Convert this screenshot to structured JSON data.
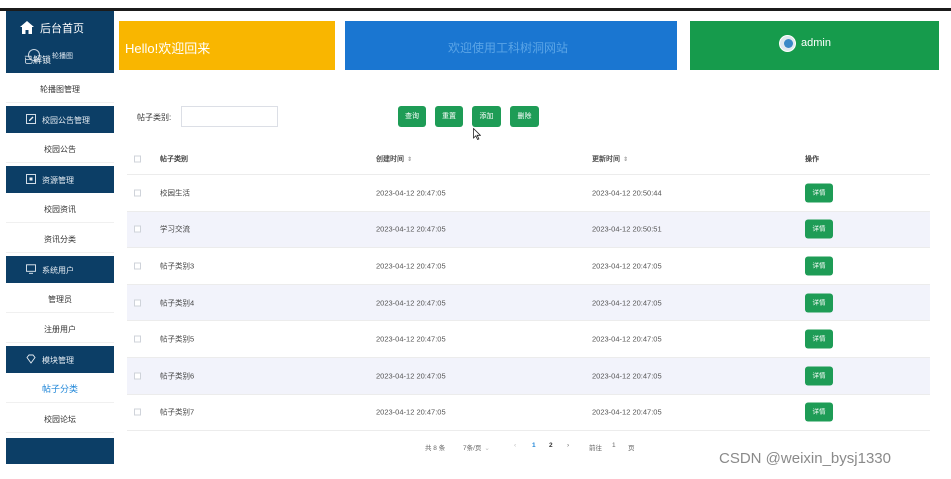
{
  "sidebar": {
    "home_title": "后台首页",
    "collapse_label": "已解锁",
    "carousel_sub": "轮播图",
    "items": [
      {
        "type": "item",
        "label": "轮播图管理"
      },
      {
        "type": "group",
        "label": "校园公告管理",
        "icon": "edit-icon"
      },
      {
        "type": "item",
        "label": "校园公告"
      },
      {
        "type": "group",
        "label": "资源管理",
        "icon": "box-icon"
      },
      {
        "type": "item",
        "label": "校园资讯"
      },
      {
        "type": "item",
        "label": "资讯分类"
      },
      {
        "type": "group",
        "label": "系统用户",
        "icon": "monitor-icon"
      },
      {
        "type": "item",
        "label": "管理员"
      },
      {
        "type": "item",
        "label": "注册用户"
      },
      {
        "type": "group",
        "label": "模块管理",
        "icon": "diamond-icon"
      },
      {
        "type": "item",
        "label": "帖子分类",
        "active": true
      },
      {
        "type": "item",
        "label": "校园论坛"
      }
    ]
  },
  "header": {
    "welcome": "Hello!欢迎回来",
    "site_title": "欢迎使用工科树洞网站",
    "username": "admin"
  },
  "search": {
    "label": "帖子类别:",
    "value": "",
    "buttons": {
      "query": "查询",
      "reset": "重置",
      "add": "添加",
      "delete": "删除"
    }
  },
  "table": {
    "headers": {
      "type": "帖子类别",
      "created": "创建时间",
      "updated": "更新时间",
      "op": "操作"
    },
    "sort_arrows": "⇕",
    "detail_label": "详情",
    "rows": [
      {
        "type": "校园生活",
        "created": "2023-04-12 20:47:05",
        "updated": "2023-04-12 20:50:44"
      },
      {
        "type": "学习交流",
        "created": "2023-04-12 20:47:05",
        "updated": "2023-04-12 20:50:51"
      },
      {
        "type": "帖子类别3",
        "created": "2023-04-12 20:47:05",
        "updated": "2023-04-12 20:47:05"
      },
      {
        "type": "帖子类别4",
        "created": "2023-04-12 20:47:05",
        "updated": "2023-04-12 20:47:05"
      },
      {
        "type": "帖子类别5",
        "created": "2023-04-12 20:47:05",
        "updated": "2023-04-12 20:47:05"
      },
      {
        "type": "帖子类别6",
        "created": "2023-04-12 20:47:05",
        "updated": "2023-04-12 20:47:05"
      },
      {
        "type": "帖子类别7",
        "created": "2023-04-12 20:47:05",
        "updated": "2023-04-12 20:47:05"
      }
    ]
  },
  "pagination": {
    "total": "共 8 条",
    "page_size": "7条/页",
    "page_size_arrow": "⌄",
    "prev": "‹",
    "page1": "1",
    "page2": "2",
    "next": "›",
    "goto": "前往",
    "goto_value": "1",
    "unit": "页"
  },
  "watermark": "CSDN @weixin_bysj1330",
  "colors": {
    "sidebar": "#0c3e66",
    "welcome_banner": "#f9b600",
    "title_banner": "#1a76d1",
    "user_banner": "#169b4c",
    "button": "#1e9c56",
    "active": "#1f86d8"
  }
}
